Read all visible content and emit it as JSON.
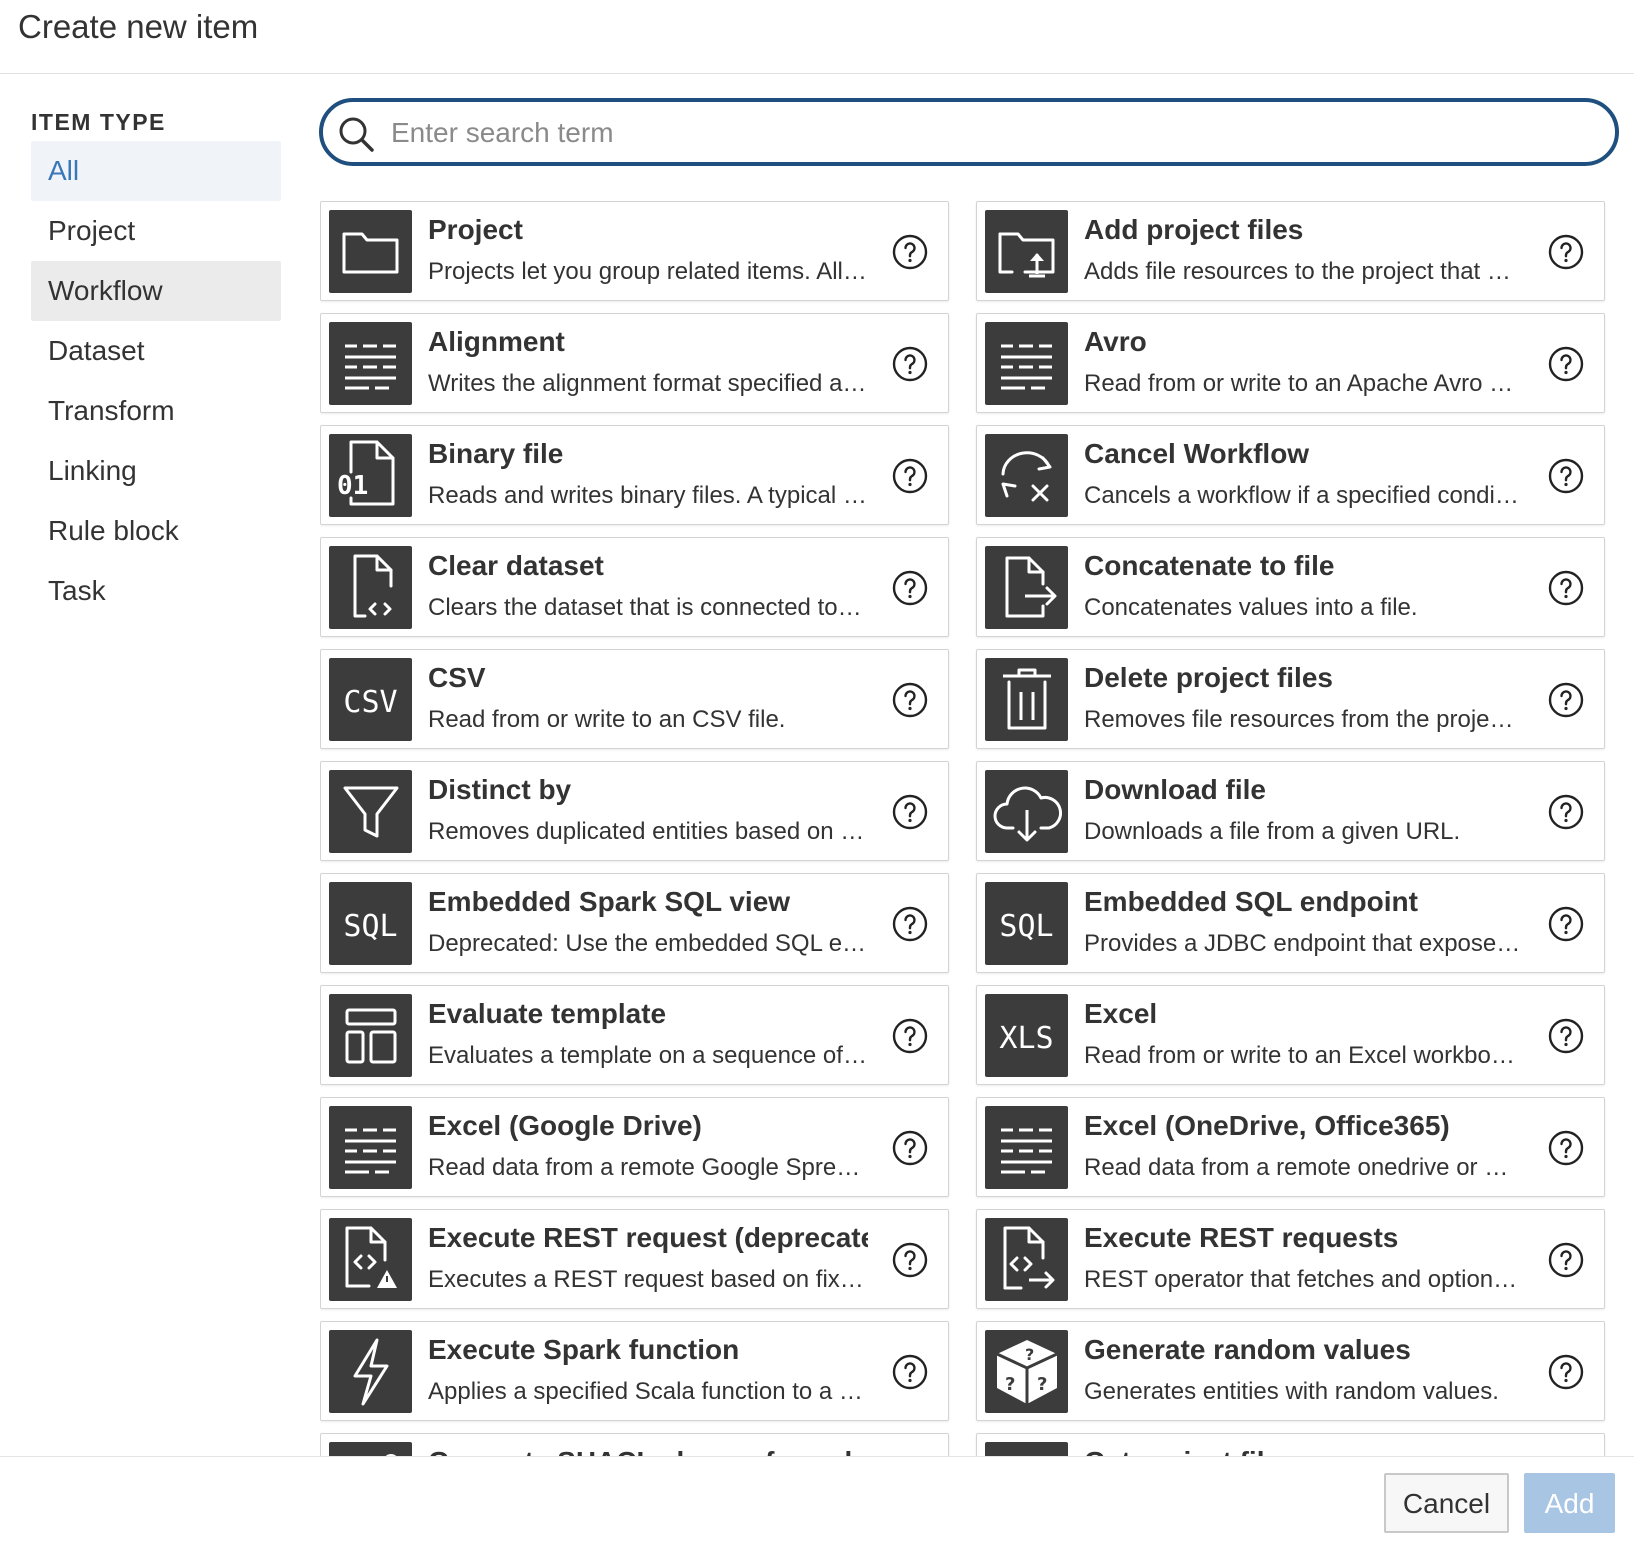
{
  "dialog": {
    "title": "Create new item"
  },
  "sidebar": {
    "heading": "ITEM TYPE",
    "items": [
      {
        "label": "All",
        "state": "selected"
      },
      {
        "label": "Project",
        "state": "normal"
      },
      {
        "label": "Workflow",
        "state": "hover"
      },
      {
        "label": "Dataset",
        "state": "normal"
      },
      {
        "label": "Transform",
        "state": "normal"
      },
      {
        "label": "Linking",
        "state": "normal"
      },
      {
        "label": "Rule block",
        "state": "normal"
      },
      {
        "label": "Task",
        "state": "normal"
      }
    ]
  },
  "search": {
    "placeholder": "Enter search term",
    "value": ""
  },
  "cards": [
    {
      "name": "Project",
      "desc": "Projects let you group related items. All…",
      "icon": "folder-icon"
    },
    {
      "name": "Add project files",
      "desc": "Adds file resources to the project that …",
      "icon": "folder-upload-icon"
    },
    {
      "name": "Alignment",
      "desc": "Writes the alignment format specified a…",
      "icon": "lines-icon"
    },
    {
      "name": "Avro",
      "desc": "Read from or write to an Apache Avro …",
      "icon": "lines-icon"
    },
    {
      "name": "Binary file",
      "desc": "Reads and writes binary files. A typical …",
      "icon": "binary-file-icon"
    },
    {
      "name": "Cancel Workflow",
      "desc": "Cancels a workflow if a specified condi…",
      "icon": "cancel-workflow-icon"
    },
    {
      "name": "Clear dataset",
      "desc": "Clears the dataset that is connected to…",
      "icon": "file-code-icon"
    },
    {
      "name": "Concatenate to file",
      "desc": "Concatenates values into a file.",
      "icon": "file-export-icon"
    },
    {
      "name": "CSV",
      "desc": "Read from or write to an CSV file.",
      "icon": "csv-icon"
    },
    {
      "name": "Delete project files",
      "desc": "Removes file resources from the proje…",
      "icon": "trash-icon"
    },
    {
      "name": "Distinct by",
      "desc": "Removes duplicated entities based on …",
      "icon": "filter-icon"
    },
    {
      "name": "Download file",
      "desc": "Downloads a file from a given URL.",
      "icon": "cloud-download-icon"
    },
    {
      "name": "Embedded Spark SQL view",
      "desc": "Deprecated: Use the embedded SQL e…",
      "icon": "sql-icon"
    },
    {
      "name": "Embedded SQL endpoint",
      "desc": "Provides a JDBC endpoint that expose…",
      "icon": "sql-icon"
    },
    {
      "name": "Evaluate template",
      "desc": "Evaluates a template on a sequence of…",
      "icon": "template-icon"
    },
    {
      "name": "Excel",
      "desc": "Read from or write to an Excel workbo…",
      "icon": "xls-icon"
    },
    {
      "name": "Excel (Google Drive)",
      "desc": "Read data from a remote Google Spre…",
      "icon": "lines-icon"
    },
    {
      "name": "Excel (OneDrive, Office365)",
      "desc": "Read data from a remote onedrive or …",
      "icon": "lines-icon"
    },
    {
      "name": "Execute REST request (deprecated)",
      "desc": "Executes a REST request based on fix…",
      "icon": "file-code-warning-icon"
    },
    {
      "name": "Execute REST requests",
      "desc": "REST operator that fetches and option…",
      "icon": "file-code-arrow-icon"
    },
    {
      "name": "Execute Spark function",
      "desc": "Applies a specified Scala function to a …",
      "icon": "lightning-icon"
    },
    {
      "name": "Generate random values",
      "desc": "Generates entities with random values.",
      "icon": "random-cube-icon"
    },
    {
      "name": "Generate SHACL shapes from data",
      "desc": "",
      "icon": "shacl-icon"
    },
    {
      "name": "Get project file",
      "desc": "",
      "icon": "lines-icon"
    }
  ],
  "footer": {
    "cancel_label": "Cancel",
    "add_label": "Add"
  },
  "colors": {
    "accent": "#3a77b8",
    "search_border": "#1f4f7e",
    "icon_bg": "#3c3c3c",
    "add_disabled": "#a9c5e4"
  }
}
